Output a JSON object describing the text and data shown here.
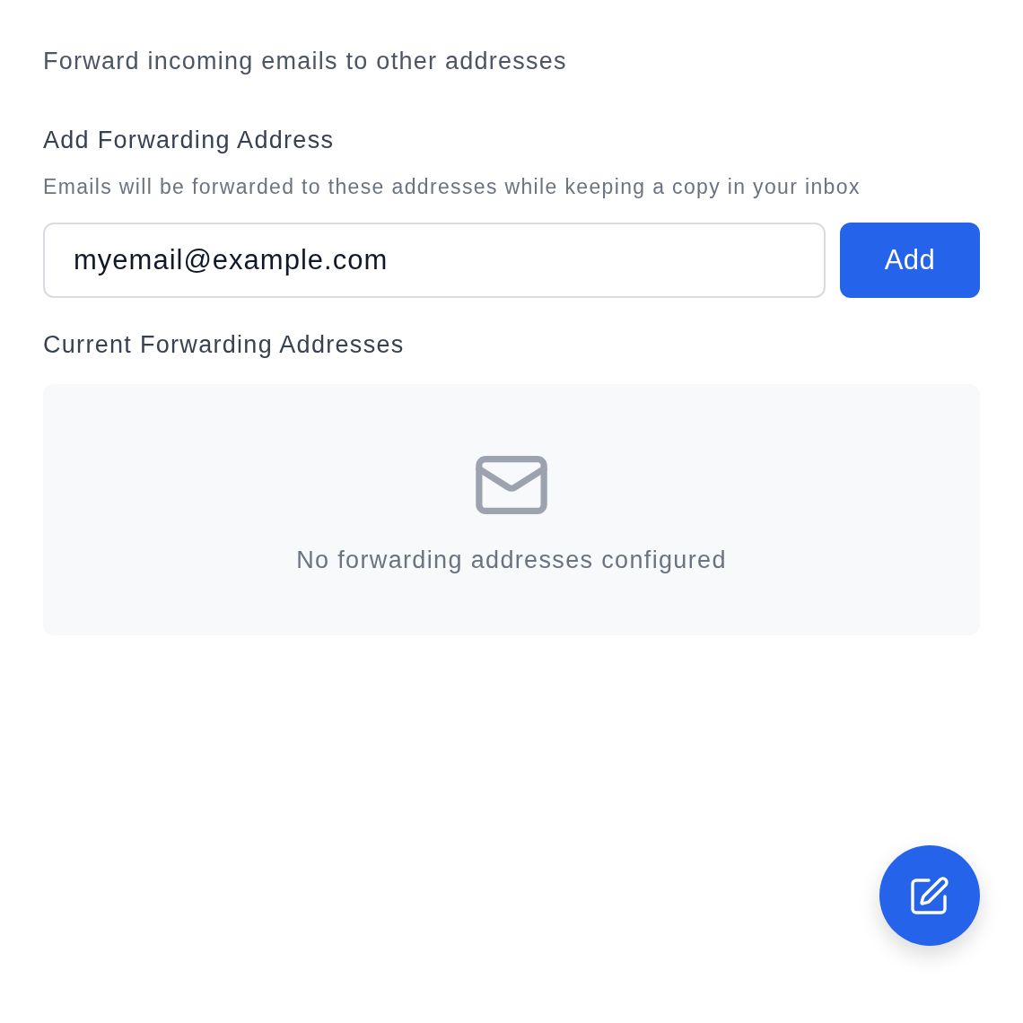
{
  "header": {
    "description": "Forward incoming emails to other addresses"
  },
  "add_section": {
    "title": "Add Forwarding Address",
    "hint": "Emails will be forwarded to these addresses while keeping a copy in your inbox",
    "email_field": {
      "value": "myemail@example.com"
    },
    "add_button": {
      "label": "Add"
    }
  },
  "current_section": {
    "title": "Current Forwarding Addresses",
    "empty_message": "No forwarding addresses configured"
  }
}
